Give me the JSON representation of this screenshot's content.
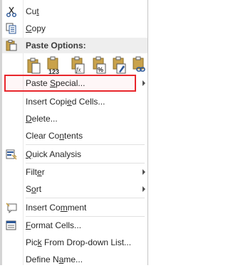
{
  "menu": {
    "cut": {
      "pre": "Cu",
      "key": "t",
      "post": "",
      "icon": "scissors-icon"
    },
    "copy": {
      "pre": "",
      "key": "C",
      "post": "opy",
      "icon": "copy-icon"
    },
    "paste_options": {
      "label": "Paste Options:",
      "icon": "paste-clipboard-icon"
    },
    "paste_buttons": [
      {
        "name": "paste-icon",
        "badge": ""
      },
      {
        "name": "paste-values-icon",
        "badge": "123"
      },
      {
        "name": "paste-formulas-icon",
        "badge": "fx"
      },
      {
        "name": "paste-formulas-number-format-icon",
        "badge": "%"
      },
      {
        "name": "paste-keep-source-formatting-icon",
        "badge": ""
      },
      {
        "name": "paste-link-icon",
        "badge": ""
      }
    ],
    "paste_special": {
      "pre": "Paste ",
      "key": "S",
      "post": "pecial..."
    },
    "insert_copied_cells": {
      "pre": "Insert Copi",
      "key": "e",
      "post": "d Cells..."
    },
    "delete": {
      "pre": "",
      "key": "D",
      "post": "elete..."
    },
    "clear_contents": {
      "pre": "Clear Co",
      "key": "n",
      "post": "tents"
    },
    "quick_analysis": {
      "pre": "",
      "key": "Q",
      "post": "uick Analysis",
      "icon": "quick-analysis-icon"
    },
    "filter": {
      "pre": "Filt",
      "key": "e",
      "post": "r"
    },
    "sort": {
      "pre": "S",
      "key": "o",
      "post": "rt"
    },
    "insert_comment": {
      "pre": "Insert Co",
      "key": "m",
      "post": "ment",
      "icon": "comment-icon"
    },
    "format_cells": {
      "pre": "",
      "key": "F",
      "post": "ormat Cells...",
      "icon": "format-cells-icon"
    },
    "pick_from_list": {
      "pre": "Pic",
      "key": "k",
      "post": " From Drop-down List..."
    },
    "define_name": {
      "pre": "Define N",
      "key": "a",
      "post": "me..."
    }
  },
  "colors": {
    "highlight_border": "#e8262c",
    "header_bg": "#eeeeee"
  }
}
